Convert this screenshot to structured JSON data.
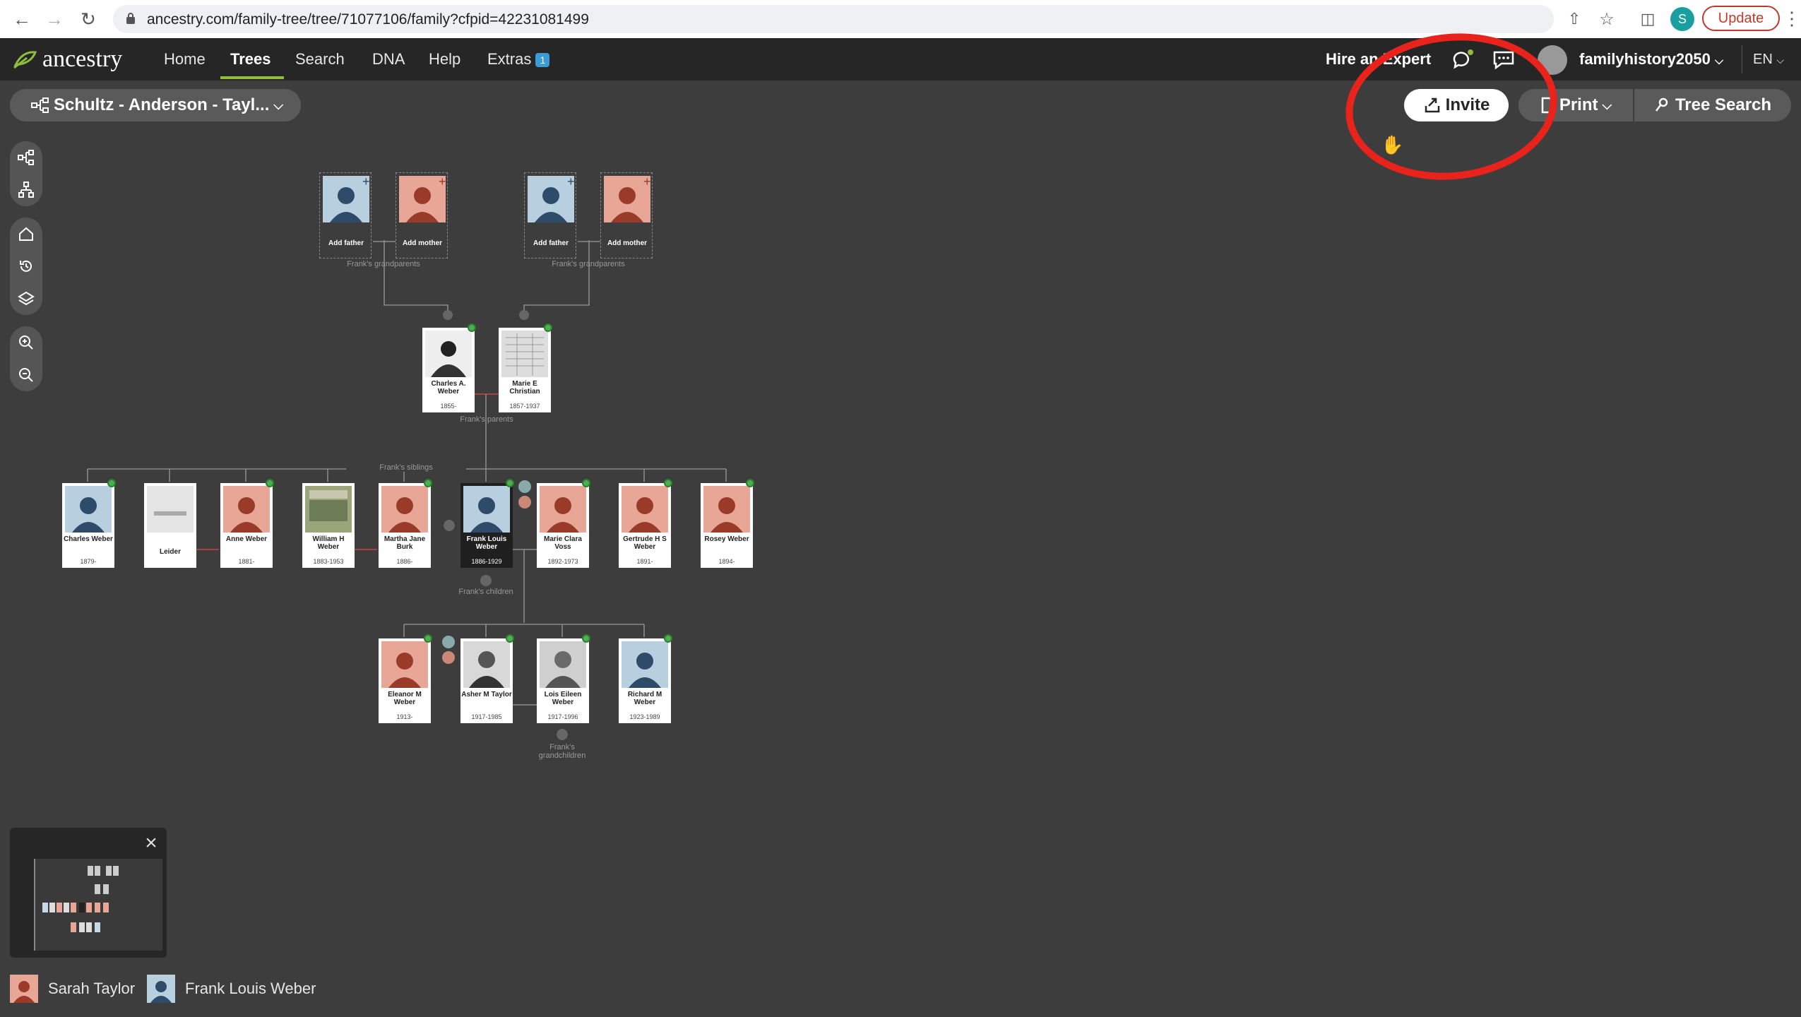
{
  "browser": {
    "url": "ancestry.com/family-tree/tree/71077106/family?cfpid=42231081499",
    "profile_initial": "S",
    "update_label": "Update"
  },
  "nav": {
    "logo": "ancestry",
    "items": [
      {
        "label": "Home"
      },
      {
        "label": "Trees",
        "active": true
      },
      {
        "label": "Search"
      },
      {
        "label": "DNA"
      },
      {
        "label": "Help"
      },
      {
        "label": "Extras",
        "badge": "1"
      }
    ],
    "hire_expert": "Hire an Expert",
    "username": "familyhistory2050",
    "language": "EN"
  },
  "toolbar": {
    "tree_name": "Schultz - Anderson - Tayl...",
    "invite": "Invite",
    "print": "Print",
    "tree_search": "Tree Search"
  },
  "tree": {
    "grandparents_label": "Frank's grandparents",
    "parents_label": "Frank's parents",
    "siblings_label": "Frank's siblings",
    "children_label": "Frank's children",
    "grandchildren_label": "Frank's grandchildren",
    "add_father": "Add father",
    "add_mother": "Add mother",
    "parents": [
      {
        "name": "Charles A. Weber",
        "dates": "1855-"
      },
      {
        "name": "Marie E Christian",
        "dates": "1857-1937"
      }
    ],
    "siblings": [
      {
        "name": "Charles Weber",
        "dates": "1879-",
        "sex": "m"
      },
      {
        "name": "Leider",
        "dates": "",
        "sex": "photo"
      },
      {
        "name": "Anne Weber",
        "dates": "1881-",
        "sex": "f"
      },
      {
        "name": "William H Weber",
        "dates": "1883-1953",
        "sex": "photo"
      },
      {
        "name": "Martha Jane Burk",
        "dates": "1886-",
        "sex": "f"
      },
      {
        "name": "Frank Louis Weber",
        "dates": "1886-1929",
        "sex": "m",
        "focus": true
      },
      {
        "name": "Marie Clara Voss",
        "dates": "1892-1973",
        "sex": "f"
      },
      {
        "name": "Gertrude H S Weber",
        "dates": "1891-",
        "sex": "f"
      },
      {
        "name": "Rosey Weber",
        "dates": "1894-",
        "sex": "f"
      }
    ],
    "children": [
      {
        "name": "Eleanor M Weber",
        "dates": "1913-",
        "sex": "f"
      },
      {
        "name": "Asher M Taylor",
        "dates": "1917-1985",
        "sex": "photo"
      },
      {
        "name": "Lois Eileen Weber",
        "dates": "1917-1996",
        "sex": "photo"
      },
      {
        "name": "Richard M Weber",
        "dates": "1923-1989",
        "sex": "m"
      }
    ]
  },
  "home_people": [
    {
      "name": "Sarah Taylor"
    },
    {
      "name": "Frank Louis Weber"
    }
  ],
  "colors": {
    "accent_green": "#8fbe3b",
    "annotation_red": "#e8231b",
    "female_bg": "#e8a696",
    "male_bg": "#b8cfe0"
  }
}
